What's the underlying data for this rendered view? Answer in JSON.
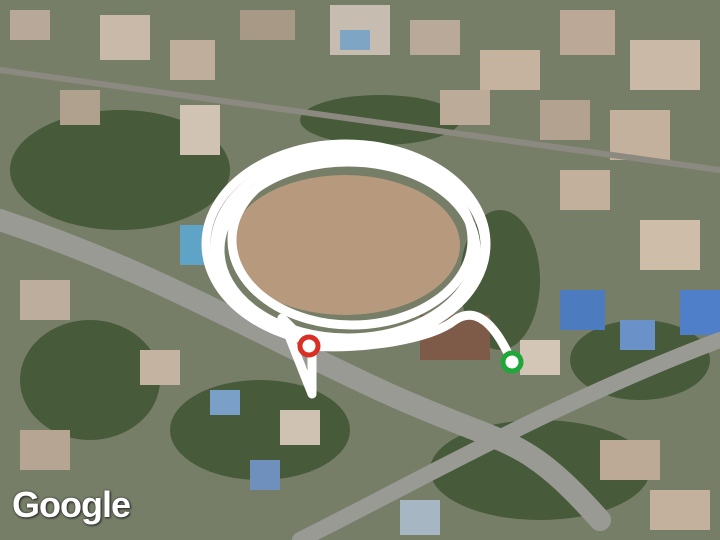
{
  "map": {
    "type": "satellite",
    "attribution": "Google",
    "track_color": "#ffffff",
    "start_marker_color": "#d93025",
    "end_marker_color": "#1fa83a"
  }
}
